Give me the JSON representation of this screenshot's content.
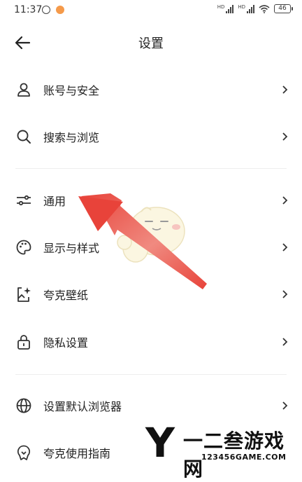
{
  "status_bar": {
    "time": "11:37",
    "signal_1": "HD",
    "signal_2": "HD",
    "battery": "46"
  },
  "header": {
    "title": "设置"
  },
  "menu": [
    {
      "label": "账号与安全",
      "icon": "person-icon"
    },
    {
      "label": "搜索与浏览",
      "icon": "search-icon"
    },
    {
      "label": "通用",
      "icon": "sliders-icon"
    },
    {
      "label": "显示与样式",
      "icon": "palette-icon"
    },
    {
      "label": "夸克壁纸",
      "icon": "wallpaper-icon"
    },
    {
      "label": "隐私设置",
      "icon": "lock-icon"
    },
    {
      "label": "设置默认浏览器",
      "icon": "globe-icon"
    },
    {
      "label": "夸克使用指南",
      "icon": "bulb-icon"
    }
  ],
  "annotation": {
    "arrow_color": "#e8433a",
    "points_to": "通用"
  },
  "watermark": {
    "letter": "Y",
    "text": "一二叁游戏网",
    "sub": "123456GAME.COM"
  }
}
